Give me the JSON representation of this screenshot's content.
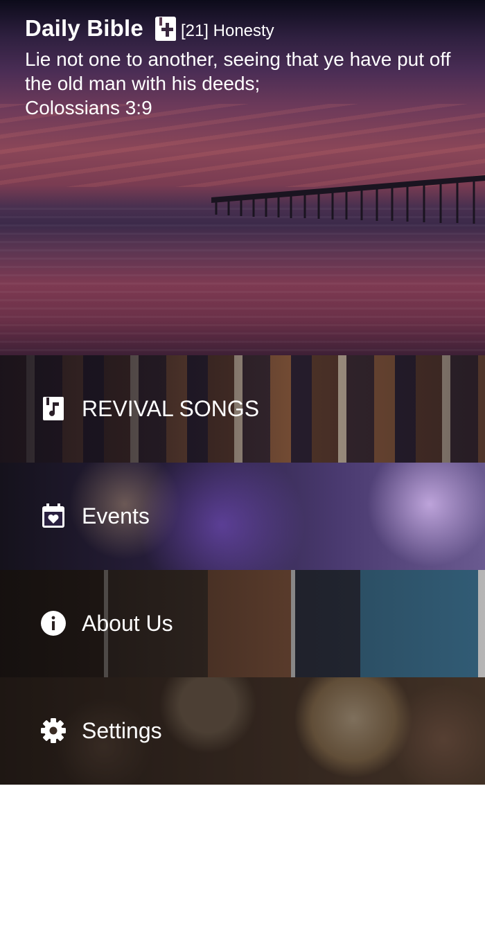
{
  "header": {
    "app_title": "Daily Bible",
    "verse_reference": "[21] Honesty",
    "verse_text": "Lie not one to another, seeing that ye have put off the old man with his deeds;",
    "verse_source": "Colossians 3:9",
    "icon": "bible-cross-icon"
  },
  "menu": {
    "items": [
      {
        "label": "REVIVAL SONGS",
        "icon": "music-note-icon"
      },
      {
        "label": "Events",
        "icon": "calendar-heart-icon"
      },
      {
        "label": "About Us",
        "icon": "info-icon"
      },
      {
        "label": "Settings",
        "icon": "gear-icon"
      }
    ]
  }
}
